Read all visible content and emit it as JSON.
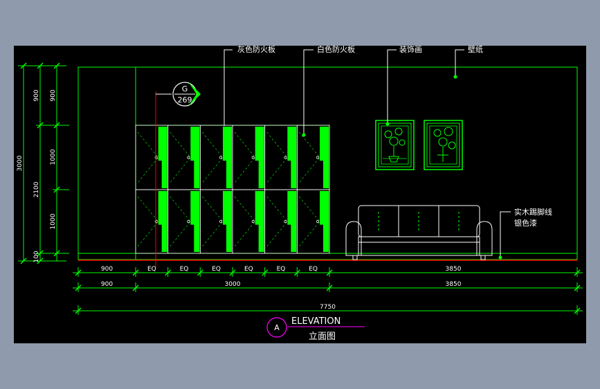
{
  "colors": {
    "background": "#8f9bac",
    "canvas": "#000000",
    "outline": "#00ff00",
    "panel_fill": "#00ff00",
    "floor_line": "#ff0000",
    "leader": "#ffffff",
    "tag": "#ff00ff",
    "text": "#ffffff"
  },
  "labels": {
    "gray_board": "灰色防火板",
    "white_board": "白色防火板",
    "decor_painting": "装饰画",
    "wallpaper": "壁纸",
    "skirting_line1": "实木踢脚线",
    "skirting_line2": "银色漆"
  },
  "section_tag": {
    "top": "G",
    "bottom": "269"
  },
  "vertical_dims": {
    "outer_total": "3000",
    "mid_top": "900",
    "mid_lower": "2100",
    "mid_base": "100",
    "inner_top": "900",
    "inner_upper": "1000",
    "inner_lower": "1000"
  },
  "horizontal_dims": {
    "row1": [
      "900",
      "EQ",
      "EQ",
      "EQ",
      "EQ",
      "EQ",
      "EQ",
      "3850"
    ],
    "row2": [
      "900",
      "3000",
      "3850"
    ],
    "row3": [
      "7750"
    ]
  },
  "title": {
    "tag": "A",
    "name": "ELEVATION",
    "subtitle": "立面图"
  }
}
